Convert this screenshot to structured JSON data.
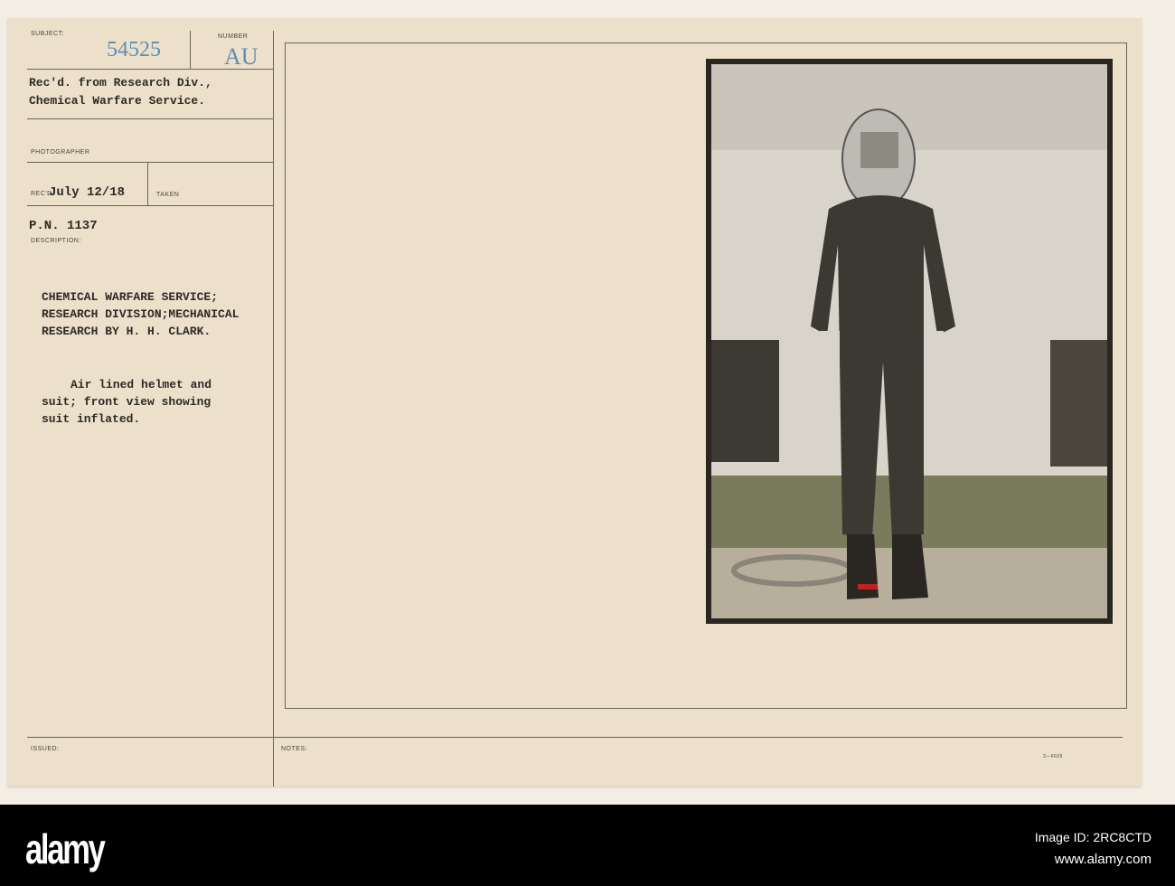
{
  "card": {
    "subject_label": "SUBJECT:",
    "subject_number": "54525",
    "number_label": "NUMBER",
    "number_value": "AU",
    "received_from": [
      "Rec'd. from Research Div.,",
      "Chemical Warfare Service."
    ],
    "photographer_label": "PHOTOGRAPHER",
    "recd_label": "REC'D",
    "recd_date": "July 12/18",
    "taken_label": "TAKEN",
    "pn": "P.N. 1137",
    "description_label": "DESCRIPTION:",
    "description_heading": [
      "CHEMICAL WARFARE SERVICE;",
      "RESEARCH DIVISION;MECHANICAL",
      "RESEARCH BY H. H. CLARK."
    ],
    "description_body": [
      "Air lined helmet and",
      "suit; front view showing",
      "suit inflated."
    ],
    "issued_label": "ISSUED:",
    "notes_label": "NOTES:",
    "form_number": "3—6605"
  },
  "footer": {
    "logo": "alamy",
    "image_id": "Image ID: 2RC8CTD",
    "url": "www.alamy.com"
  }
}
